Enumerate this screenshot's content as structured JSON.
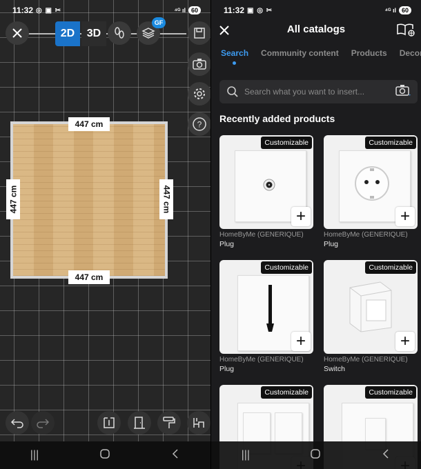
{
  "left": {
    "status": {
      "time": "11:32",
      "battery": "60"
    },
    "toolbar": {
      "mode_2d": "2D",
      "mode_3d": "3D",
      "layers_badge": "GF"
    },
    "room": {
      "top": "447 cm",
      "bottom": "447 cm",
      "left": "447 cm",
      "right": "447 cm"
    }
  },
  "right": {
    "status": {
      "time": "11:32",
      "battery": "60"
    },
    "title": "All catalogs",
    "tabs": [
      "Search",
      "Community content",
      "Products",
      "Decorati"
    ],
    "search": {
      "placeholder": "Search what you want to insert..."
    },
    "section_title": "Recently added products",
    "products": [
      {
        "badge": "Customizable",
        "brand": "HomeByMe (GENERIQUE)",
        "name": "Plug",
        "type": "coax"
      },
      {
        "badge": "Customizable",
        "brand": "HomeByMe (GENERIQUE)",
        "name": "Plug",
        "type": "socket"
      },
      {
        "badge": "Customizable",
        "brand": "HomeByMe (GENERIQUE)",
        "name": "Plug",
        "type": "cable"
      },
      {
        "badge": "Customizable",
        "brand": "HomeByMe (GENERIQUE)",
        "name": "Switch",
        "type": "switch"
      },
      {
        "badge": "Customizable",
        "brand": "",
        "name": "",
        "type": "double"
      },
      {
        "badge": "Customizable",
        "brand": "",
        "name": "",
        "type": "single"
      }
    ]
  }
}
